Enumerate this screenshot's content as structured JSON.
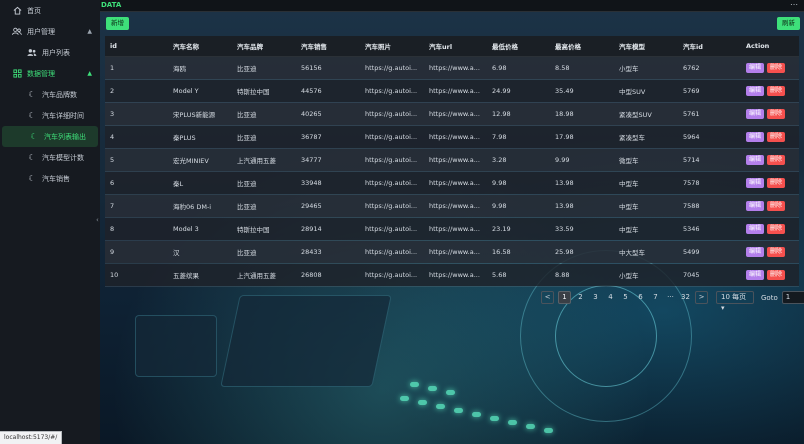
{
  "sidebar": {
    "home": "首页",
    "user_group": "用户管理",
    "user_list": "用户列表",
    "data_group": "数据管理",
    "items": [
      "汽车品牌数",
      "汽车详细时间",
      "汽车列表输出",
      "汽车模型计数",
      "汽车销售"
    ]
  },
  "status_url": "localhost:5173/#/",
  "topbar": {
    "title": "DATA"
  },
  "toolbar": {
    "add_label": "新增",
    "refresh_label": "刷新"
  },
  "table": {
    "headers": [
      "id",
      "汽车名称",
      "汽车品牌",
      "汽车销售",
      "汽车照片",
      "汽车url",
      "最低价格",
      "最高价格",
      "汽车模型",
      "汽车id",
      "Action"
    ],
    "rows": [
      [
        "1",
        "海鸥",
        "比亚迪",
        "56156",
        "https://g.autoi...",
        "https://www.a...",
        "6.98",
        "8.58",
        "小型车",
        "6762"
      ],
      [
        "2",
        "Model Y",
        "特斯拉中国",
        "44576",
        "https://g.autoi...",
        "https://www.a...",
        "24.99",
        "35.49",
        "中型SUV",
        "5769"
      ],
      [
        "3",
        "宋PLUS新能源",
        "比亚迪",
        "40265",
        "https://g.autoi...",
        "https://www.a...",
        "12.98",
        "18.98",
        "紧凑型SUV",
        "5761"
      ],
      [
        "4",
        "秦PLUS",
        "比亚迪",
        "36787",
        "https://g.autoi...",
        "https://www.a...",
        "7.98",
        "17.98",
        "紧凑型车",
        "5964"
      ],
      [
        "5",
        "宏光MINIEV",
        "上汽通用五菱",
        "34777",
        "https://g.autoi...",
        "https://www.a...",
        "3.28",
        "9.99",
        "微型车",
        "5714"
      ],
      [
        "6",
        "秦L",
        "比亚迪",
        "33948",
        "https://g.autoi...",
        "https://www.a...",
        "9.98",
        "13.98",
        "中型车",
        "7578"
      ],
      [
        "7",
        "海豹06 DM-i",
        "比亚迪",
        "29465",
        "https://g.autoi...",
        "https://www.a...",
        "9.98",
        "13.98",
        "中型车",
        "7588"
      ],
      [
        "8",
        "Model 3",
        "特斯拉中国",
        "28914",
        "https://g.autoi...",
        "https://www.a...",
        "23.19",
        "33.59",
        "中型车",
        "5346"
      ],
      [
        "9",
        "汉",
        "比亚迪",
        "28433",
        "https://g.autoi...",
        "https://www.a...",
        "16.58",
        "25.98",
        "中大型车",
        "5499"
      ],
      [
        "10",
        "五菱缤果",
        "上汽通用五菱",
        "26808",
        "https://g.autoi...",
        "https://www.a...",
        "5.68",
        "8.88",
        "小型车",
        "7045"
      ]
    ],
    "edit_label": "编辑",
    "delete_label": "删除"
  },
  "pagination": {
    "prev": "<",
    "pages": [
      "1",
      "2",
      "3",
      "4",
      "5",
      "6",
      "7"
    ],
    "ellipsis": "···",
    "last": "32",
    "next": ">",
    "page_size": "10 每页",
    "page_size_arrow": "▾",
    "goto_label": "Goto",
    "goto_value": "1"
  },
  "icons": {
    "home": "home-icon",
    "users": "users-icon",
    "user_list": "user-list-icon",
    "data": "grid-icon",
    "moon": "moon-icon",
    "dots": "more-icon",
    "collapse": "chevron-left-icon"
  },
  "colors": {
    "accent": "#3ee07a",
    "edit": "#b37feb",
    "delete": "#f5504e"
  }
}
